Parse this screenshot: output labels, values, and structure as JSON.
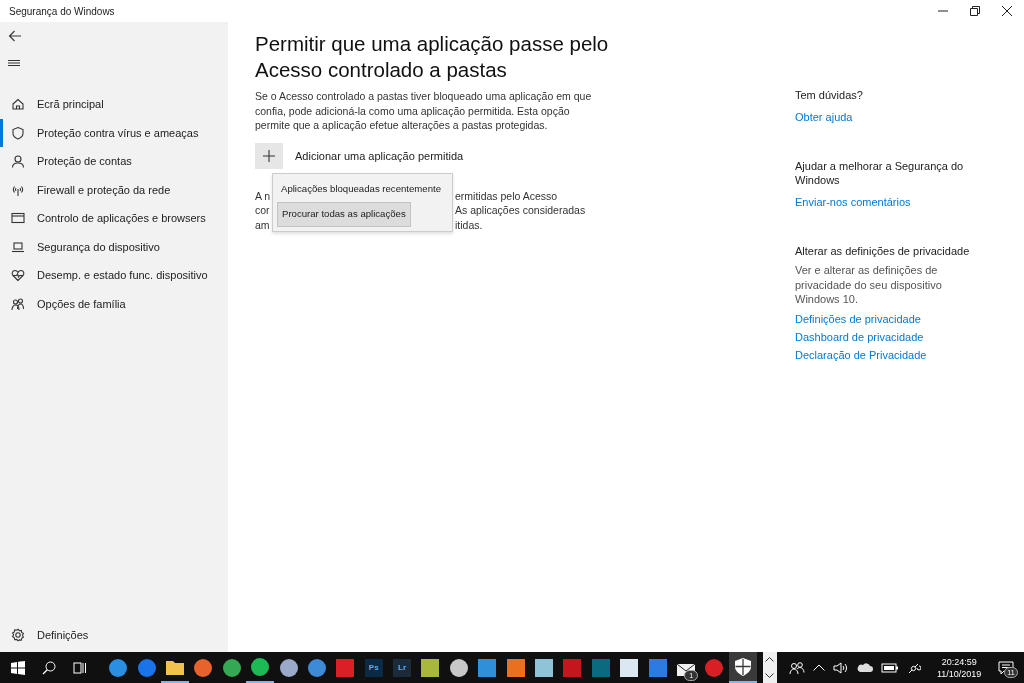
{
  "window": {
    "title": "Segurança do Windows"
  },
  "sidebar": {
    "items": [
      {
        "kind": "home",
        "label": "Ecrã principal",
        "selected": false
      },
      {
        "kind": "shield",
        "label": "Proteção contra vírus e ameaças",
        "selected": true
      },
      {
        "kind": "person",
        "label": "Proteção de contas",
        "selected": false
      },
      {
        "kind": "antenna",
        "label": "Firewall e proteção da rede",
        "selected": false
      },
      {
        "kind": "window",
        "label": "Controlo de aplicações e browsers",
        "selected": false
      },
      {
        "kind": "laptop",
        "label": "Segurança do dispositivo",
        "selected": false
      },
      {
        "kind": "heart",
        "label": "Desemp. e estado func. dispositivo",
        "selected": false
      },
      {
        "kind": "family",
        "label": "Opções de família",
        "selected": false
      }
    ],
    "settings": "Definições"
  },
  "main": {
    "title": "Permitir que uma aplicação passe pelo Acesso controlado a pastas",
    "description": "Se o Acesso controlado a pastas tiver bloqueado uma aplicação em que confia, pode adicioná-la como uma aplicação permitida. Esta opção permite que a aplicação efetue alterações a pastas protegidas.",
    "add_button": "Adicionar uma aplicação permitida",
    "covered_lines": [
      {
        "left": "A n",
        "right": "ermitidas pelo Acesso"
      },
      {
        "left": "cor",
        "right": "As aplicações consideradas"
      },
      {
        "left": "am",
        "right": "itidas."
      }
    ],
    "menu": [
      {
        "label": "Aplicações bloqueadas recentemente",
        "selected": false
      },
      {
        "label": "Procurar todas as aplicações",
        "selected": true
      }
    ]
  },
  "aside": [
    {
      "heading": "Tem dúvidas?",
      "links": [
        "Obter ajuda"
      ]
    },
    {
      "heading": "Ajudar a melhorar a Segurança do Windows",
      "links": [
        "Enviar-nos comentários"
      ]
    },
    {
      "heading": "Alterar as definições de privacidade",
      "text": "Ver e alterar as definições de privacidade do seu dispositivo Windows 10.",
      "links": [
        "Definições de privacidade",
        "Dashboard de privacidade",
        "Declaração de Privacidade"
      ]
    }
  ],
  "taskbar": {
    "apps": [
      {
        "kind": "circle",
        "color": "#2a8fe0",
        "running": false,
        "selected": false
      },
      {
        "kind": "circle",
        "color": "#1a73e8",
        "running": false,
        "selected": false
      },
      {
        "kind": "folder",
        "color": "#f2c14e",
        "running": true,
        "selected": false
      },
      {
        "kind": "circle",
        "color": "#e8622c",
        "running": false,
        "selected": false
      },
      {
        "kind": "circle",
        "color": "#34a853",
        "running": false,
        "selected": false
      },
      {
        "kind": "circle",
        "color": "#1db954",
        "running": true,
        "selected": false
      },
      {
        "kind": "circle",
        "color": "#9aa9c9",
        "running": false,
        "selected": false
      },
      {
        "kind": "circle",
        "color": "#3d8bd8",
        "running": false,
        "selected": false
      },
      {
        "kind": "square",
        "color": "#da1f26",
        "running": false,
        "selected": false
      },
      {
        "kind": "square",
        "color": "#0b2a45",
        "label": "Ps",
        "running": false,
        "selected": false
      },
      {
        "kind": "square",
        "color": "#1c2b3a",
        "label": "Lr",
        "running": false,
        "selected": false
      },
      {
        "kind": "square",
        "color": "#a9b73a",
        "running": false,
        "selected": false
      },
      {
        "kind": "circle",
        "color": "#c8c8c8",
        "running": false,
        "selected": false
      },
      {
        "kind": "square",
        "color": "#2f8fd8",
        "running": false,
        "selected": false
      },
      {
        "kind": "square",
        "color": "#e8701f",
        "running": false,
        "selected": false
      },
      {
        "kind": "square",
        "color": "#8fc3d8",
        "running": false,
        "selected": false
      },
      {
        "kind": "square",
        "color": "#c4161c",
        "running": false,
        "selected": false
      },
      {
        "kind": "square",
        "color": "#0a6b80",
        "running": false,
        "selected": false
      },
      {
        "kind": "square",
        "color": "#dbe8f3",
        "running": false,
        "selected": false
      },
      {
        "kind": "square",
        "color": "#2d7be0",
        "running": false,
        "selected": false
      },
      {
        "kind": "mail",
        "color": "#f0f0f0",
        "badge": "1",
        "running": false,
        "selected": false
      },
      {
        "kind": "circle",
        "color": "#d81f26",
        "running": false,
        "selected": false
      },
      {
        "kind": "shield",
        "color": "#ffffff",
        "running": true,
        "selected": true
      }
    ],
    "time": "20:24:59",
    "date": "11/10/2019",
    "notifications": "11"
  }
}
